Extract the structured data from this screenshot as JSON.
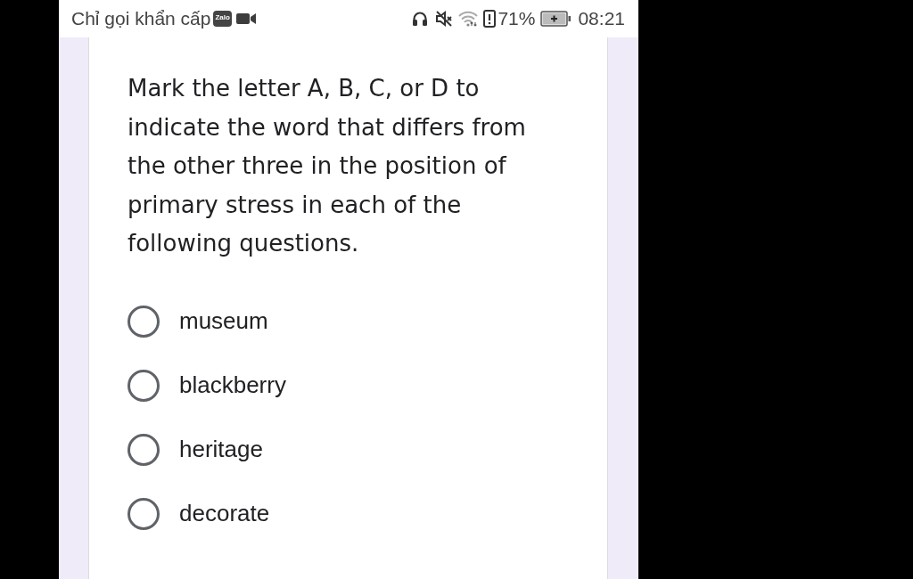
{
  "status_bar": {
    "carrier": "Chỉ gọi khẩn cấp",
    "app_badge": "Zalo",
    "battery_percent": "71%",
    "time": "08:21"
  },
  "question": {
    "text": "Mark the letter A, B, C, or D to indicate the word that differs from the other three in the position of primary stress in each of the following questions.",
    "options": [
      {
        "label": "museum",
        "selected": false
      },
      {
        "label": "blackberry",
        "selected": false
      },
      {
        "label": "heritage",
        "selected": false
      },
      {
        "label": "decorate",
        "selected": false
      }
    ]
  }
}
